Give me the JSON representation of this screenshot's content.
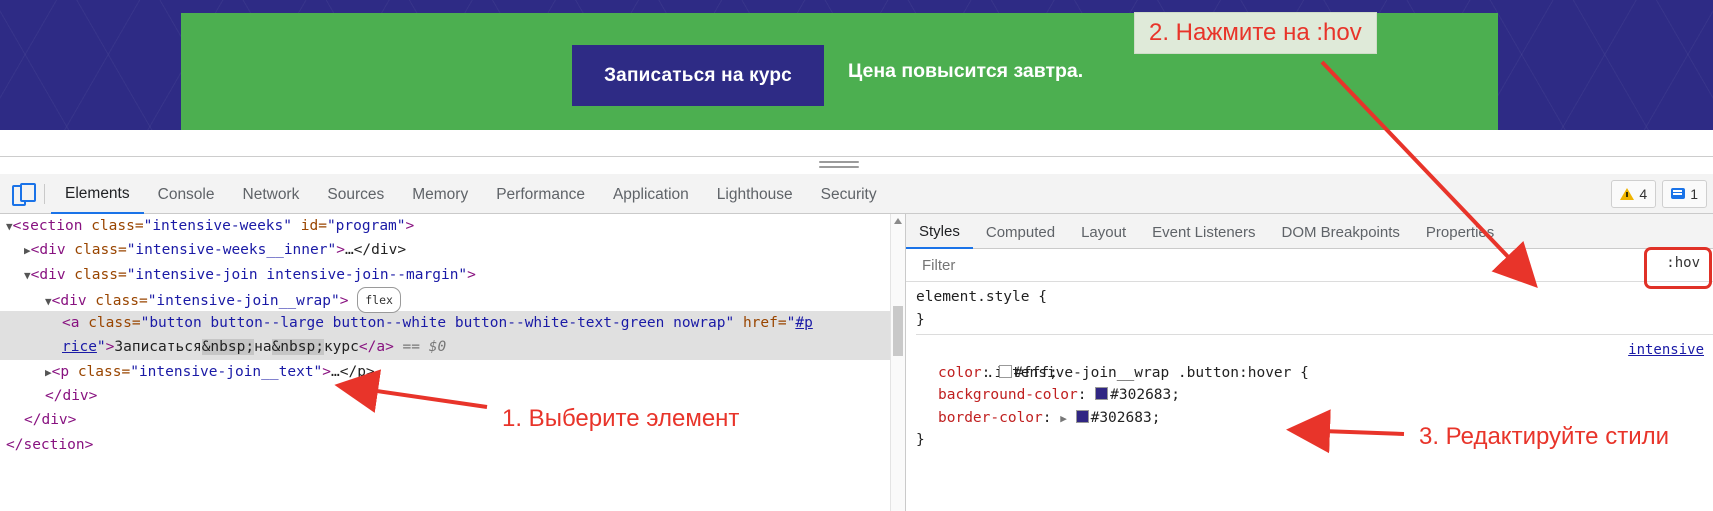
{
  "preview": {
    "button_label": "Записаться на курс",
    "banner_note": "Цена повысится завтра.",
    "banner_bg": "#4caf50",
    "button_bg": "#2e2b85"
  },
  "devtools": {
    "tabs": [
      {
        "label": "Elements",
        "active": true
      },
      {
        "label": "Console",
        "active": false
      },
      {
        "label": "Network",
        "active": false
      },
      {
        "label": "Sources",
        "active": false
      },
      {
        "label": "Memory",
        "active": false
      },
      {
        "label": "Performance",
        "active": false
      },
      {
        "label": "Application",
        "active": false
      },
      {
        "label": "Lighthouse",
        "active": false
      },
      {
        "label": "Security",
        "active": false
      }
    ],
    "warning_count": "4",
    "message_count": "1"
  },
  "dom": {
    "rows": [
      {
        "id": "row-section-open"
      },
      {
        "id": "row-inner-div"
      },
      {
        "id": "row-join-div"
      },
      {
        "id": "row-wrap-div"
      },
      {
        "id": "row-anchor-1"
      },
      {
        "id": "row-anchor-2"
      },
      {
        "id": "row-p-text"
      },
      {
        "id": "row-close-div-1"
      },
      {
        "id": "row-close-div-2"
      },
      {
        "id": "row-close-section"
      }
    ],
    "section_tag": "section",
    "section_class_attr": "class",
    "section_class_val": "\"intensive-weeks\"",
    "section_id_attr": "id",
    "section_id_val": "\"program\"",
    "div_tag": "div",
    "inner_class_val": "\"intensive-weeks__inner\"",
    "inner_ellipsis": "…</div>",
    "join_class_val": "\"intensive-join intensive-join--margin\"",
    "wrap_class_val": "\"intensive-join__wrap\"",
    "flex_badge": "flex",
    "a_tag": "a",
    "a_class_val": "\"button button--large button--white button--white-text-green nowrap\"",
    "a_href_attr": "href=",
    "a_href_val": "\"#p",
    "a_href_val_cont": "rice\"",
    "a_text": "Записаться",
    "a_nbsp": "&nbsp;",
    "a_text2": "на",
    "a_text3": "курс",
    "a_close": "</a>",
    "a_eq": "== $0",
    "p_tag": "p",
    "p_class_val": "\"intensive-join__text\"",
    "p_ellipsis": "…</p>",
    "close_div": "</div>",
    "close_section": "</section>"
  },
  "styles": {
    "tabs": [
      {
        "label": "Styles",
        "active": true
      },
      {
        "label": "Computed",
        "active": false
      },
      {
        "label": "Layout",
        "active": false
      },
      {
        "label": "Event Listeners",
        "active": false
      },
      {
        "label": "DOM Breakpoints",
        "active": false
      },
      {
        "label": "Properties",
        "active": false
      }
    ],
    "filter_placeholder": "Filter",
    "filter_value": "",
    "hov_label": ":hov",
    "element_style_open": "element.style {",
    "element_style_close": "}",
    "rule_selector": ".intensive-join__wrap .button:hover {",
    "rule_source": "intensive",
    "rule_close": "}",
    "declarations": [
      {
        "property": "color",
        "value": "#fff",
        "swatch": "#ffffff",
        "expandable": false
      },
      {
        "property": "background-color",
        "value": "#302683",
        "swatch": "#302683",
        "expandable": false
      },
      {
        "property": "border-color",
        "value": "#302683",
        "swatch": "#302683",
        "expandable": true
      }
    ]
  },
  "annotations": {
    "step1": "1. Выберите элемент",
    "step2": "2. Нажмите на :hov",
    "step3": "3. Редактируйте стили",
    "color": "#e8342a"
  }
}
